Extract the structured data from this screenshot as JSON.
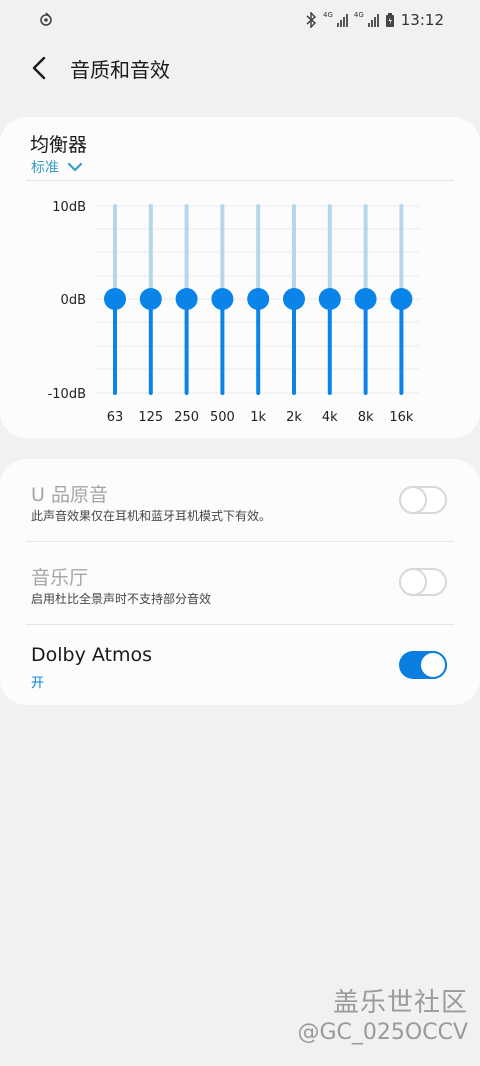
{
  "status_bar": {
    "time": "13:12",
    "network_1": "4G",
    "network_2": "4G",
    "left_icon": "notification-icon",
    "icons": [
      "bluetooth-icon",
      "signal-icon",
      "battery-icon"
    ]
  },
  "header": {
    "title": "音质和音效",
    "back_icon": "back-arrow-icon"
  },
  "equalizer": {
    "title": "均衡器",
    "preset": "标准",
    "db_labels": [
      "10dB",
      "0dB",
      "-10dB"
    ],
    "bands": [
      {
        "label": "63",
        "value": 0
      },
      {
        "label": "125",
        "value": 0
      },
      {
        "label": "250",
        "value": 0
      },
      {
        "label": "500",
        "value": 0
      },
      {
        "label": "1k",
        "value": 0
      },
      {
        "label": "2k",
        "value": 0
      },
      {
        "label": "4k",
        "value": 0
      },
      {
        "label": "8k",
        "value": 0
      },
      {
        "label": "16k",
        "value": 0
      }
    ],
    "range": [
      -10,
      10
    ],
    "accent_color": "#0a84e8",
    "track_light_color": "#b5d7ea"
  },
  "options": [
    {
      "title": "U 品原音",
      "subtitle": "此声音效果仅在耳机和蓝牙耳机模式下有效。",
      "enabled": false,
      "on": false
    },
    {
      "title": "音乐厅",
      "subtitle": "启用杜比全景声时不支持部分音效",
      "enabled": false,
      "on": false
    },
    {
      "title": "Dolby Atmos",
      "subtitle": "开",
      "enabled": true,
      "on": true
    }
  ],
  "watermark": {
    "line1": "盖乐世社区",
    "line2": "@GC_025OCCV"
  },
  "colors": {
    "accent": "#0a7fe0",
    "link": "#3a9ec3",
    "background": "#f1f1f1"
  }
}
